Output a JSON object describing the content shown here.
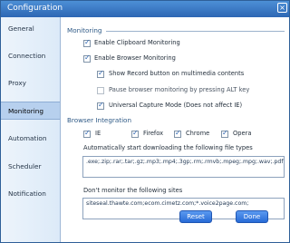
{
  "window": {
    "title": "Configuration",
    "close_glyph": "×"
  },
  "sidebar": {
    "items": [
      {
        "label": "General",
        "active": false
      },
      {
        "label": "Connection",
        "active": false
      },
      {
        "label": "Proxy",
        "active": false
      },
      {
        "label": "Monitoring",
        "active": true
      },
      {
        "label": "Automation",
        "active": false
      },
      {
        "label": "Scheduler",
        "active": false
      },
      {
        "label": "Notification",
        "active": false
      }
    ]
  },
  "monitoring": {
    "section_title": "Monitoring",
    "options": [
      {
        "label": "Enable Clipboard Monitoring",
        "checked": true
      },
      {
        "label": "Enable Browser Monitoring",
        "checked": true
      },
      {
        "label": "Show Record button on multimedia contents",
        "checked": true
      },
      {
        "label": "Pause browser monitoring by pressing ALT key",
        "checked": false
      },
      {
        "label": "Universal Capture Mode (Does not affect IE)",
        "checked": true
      }
    ]
  },
  "browser_integration": {
    "section_title": "Browser Integration",
    "browsers": [
      {
        "label": "IE",
        "checked": true
      },
      {
        "label": "Firefox",
        "checked": true
      },
      {
        "label": "Chrome",
        "checked": true
      },
      {
        "label": "Opera",
        "checked": true
      }
    ],
    "filetypes_label": "Automatically start downloading the following file types",
    "filetypes_value": ".exe;.zip;.rar;.tar;.gz;.mp3;.mp4;.3gp;.rm;.rmvb;.mpeg;.mpg;.wav;.pdf;.chm;.iso;.msi;.7z;.aac;.ape;.flac;.mkv;.mov;.ogg;.torrent;",
    "sites_label": "Don't monitor the following sites",
    "sites_value": "siteseal.thawte.com;ecom.cimetz.com;*.voice2page.com;"
  },
  "buttons": {
    "reset": "Reset",
    "done": "Done"
  },
  "colors": {
    "title_bar": "#2d67b4",
    "sidebar_active": "#b7d0ee",
    "buttons": "#286bd6"
  }
}
